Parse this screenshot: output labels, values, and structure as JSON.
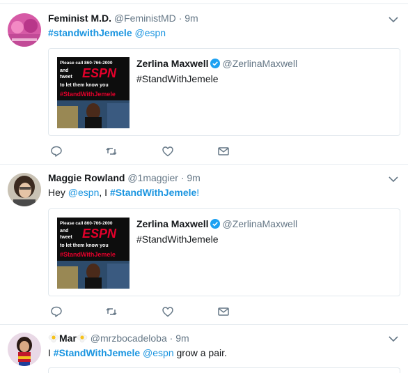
{
  "tweets": [
    {
      "name": "Feminist M.D.",
      "handle": "@FeministMD",
      "separator": "·",
      "time": "9m",
      "text_parts": [
        "#standwithJemele",
        " ",
        "@espn"
      ],
      "quoted": {
        "name": "Zerlina Maxwell",
        "handle": "@ZerlinaMaxwell",
        "text": "#StandWithJemele",
        "image_lines": [
          "Please call 860-766-2000",
          "and",
          "tweet",
          "to let them know you",
          "#StandWithJemele"
        ],
        "image_logo": "ESPN"
      }
    },
    {
      "name": "Maggie Rowland",
      "handle": "@1maggier",
      "separator": "·",
      "time": "9m",
      "text_parts": [
        "Hey ",
        "@espn",
        ", I ",
        "#StandWithJemele",
        "!"
      ],
      "quoted": {
        "name": "Zerlina Maxwell",
        "handle": "@ZerlinaMaxwell",
        "text": "#StandWithJemele",
        "image_lines": [
          "Please call 860-766-2000",
          "and",
          "tweet",
          "to let them know you",
          "#StandWithJemele"
        ],
        "image_logo": "ESPN"
      }
    },
    {
      "name": "Mar",
      "handle": "@mrzbocadeloba",
      "separator": "·",
      "time": "9m",
      "text_parts": [
        "I ",
        "#StandWithJemele",
        " ",
        "@espn",
        " grow a pair."
      ]
    }
  ],
  "colors": {
    "link": "#1b95e0",
    "verified": "#1da1f2",
    "muted": "#657786",
    "border": "#e6ecf0"
  },
  "icons": [
    "reply-icon",
    "retweet-icon",
    "like-icon",
    "direct-message-icon",
    "chevron-down-icon",
    "verified-badge-icon",
    "flower-emoji-icon"
  ]
}
